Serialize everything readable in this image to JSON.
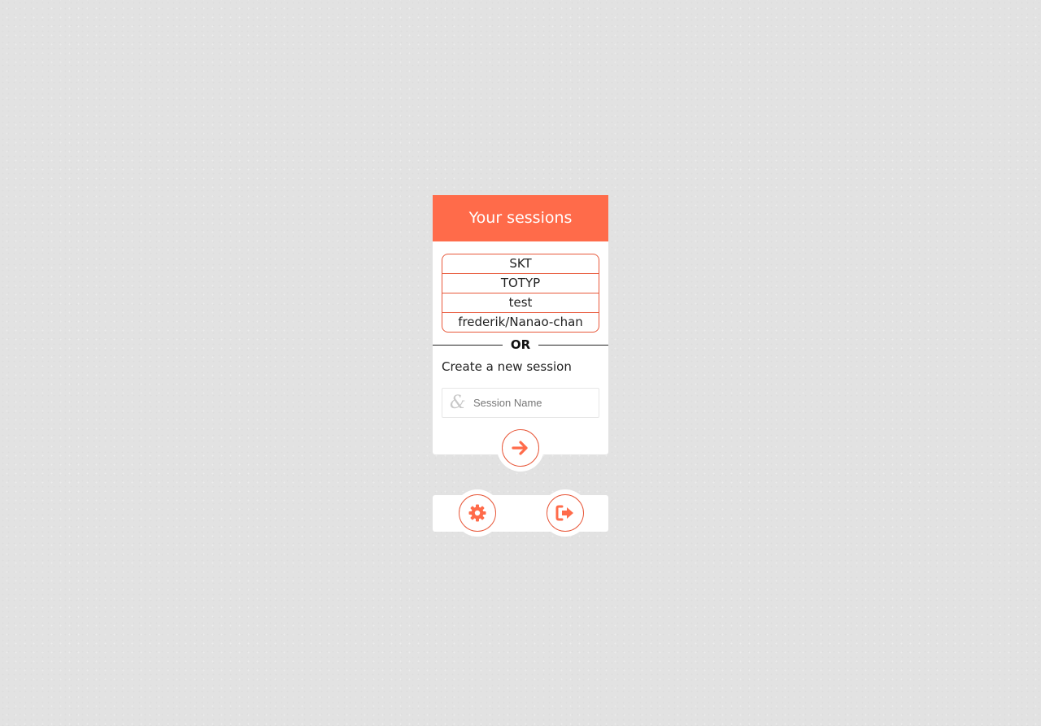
{
  "colors": {
    "accent": "#ff6b4a",
    "accent_border": "#e8583a",
    "background": "#e2e2e2",
    "card": "#ffffff"
  },
  "header": {
    "title": "Your sessions"
  },
  "sessions": [
    {
      "label": "SKT"
    },
    {
      "label": "TOTYP"
    },
    {
      "label": "test"
    },
    {
      "label": "frederik/Nanao-chan"
    }
  ],
  "divider": {
    "label": "OR"
  },
  "create": {
    "label": "Create a new session",
    "input_icon": "ampersand-icon",
    "input_value": "",
    "input_placeholder": "Session Name",
    "submit_icon": "arrow-right-icon"
  },
  "footer": {
    "settings_icon": "gear-icon",
    "logout_icon": "sign-out-icon"
  }
}
